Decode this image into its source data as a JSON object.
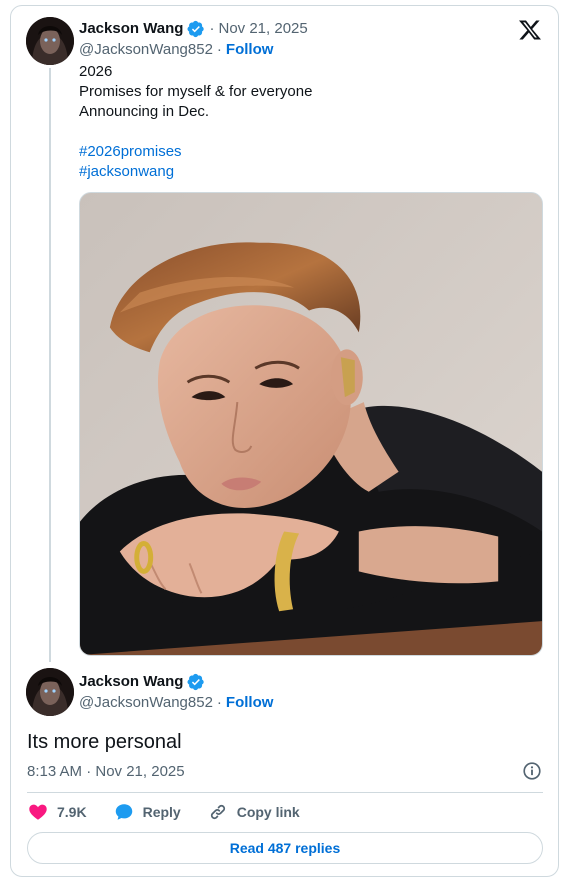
{
  "tweet": {
    "author_name": "Jackson Wang",
    "handle": "@JacksonWang852",
    "separator": "·",
    "date": "Nov 21, 2025",
    "follow_label": "Follow",
    "lines": [
      "2026",
      "Promises for myself & for everyone",
      "Announcing in Dec."
    ],
    "hashtags": [
      "#2026promises",
      "#jacksonwang"
    ]
  },
  "reply": {
    "author_name": "Jackson Wang",
    "handle": "@JacksonWang852",
    "separator": "·",
    "follow_label": "Follow",
    "text": "Its more personal",
    "timestamp": "8:13 AM · Nov 21, 2025",
    "likes": "7.9K",
    "reply_label": "Reply",
    "copy_link_label": "Copy link",
    "read_replies_label": "Read 487 replies"
  },
  "colors": {
    "link_blue": "#006fd6",
    "verified_blue": "#1d9bf0",
    "like_pink": "#f91880",
    "muted_gray": "#536471",
    "border": "#cfd9de"
  },
  "icons": {
    "brand": "x-logo-icon",
    "verified": "verified-badge-icon",
    "info": "info-icon",
    "like": "heart-icon",
    "reply": "speech-bubble-icon",
    "copy_link": "link-icon"
  }
}
